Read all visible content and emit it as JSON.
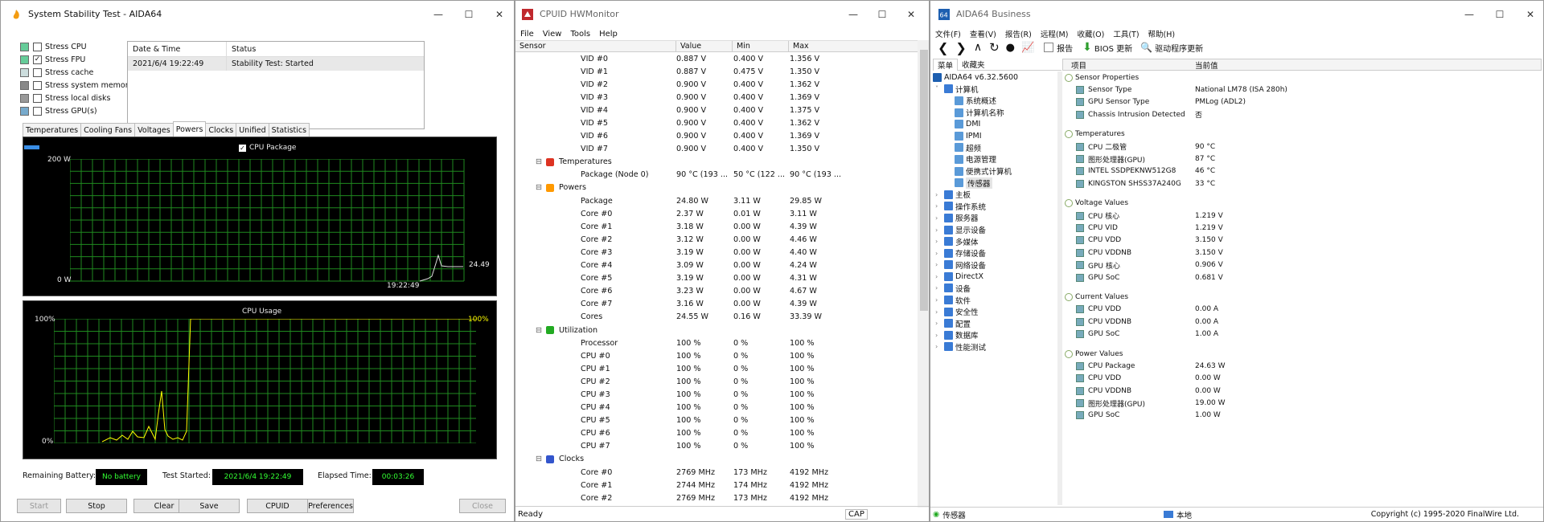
{
  "stability": {
    "title": "System Stability Test - AIDA64",
    "checks": [
      {
        "label": "Stress CPU",
        "checked": false
      },
      {
        "label": "Stress FPU",
        "checked": true
      },
      {
        "label": "Stress cache",
        "checked": false
      },
      {
        "label": "Stress system memory",
        "checked": false
      },
      {
        "label": "Stress local disks",
        "checked": false
      },
      {
        "label": "Stress GPU(s)",
        "checked": false
      }
    ],
    "log": {
      "col_date": "Date & Time",
      "col_status": "Status",
      "date": "2021/6/4 19:22:49",
      "status": "Stability Test: Started"
    },
    "tabs": [
      "Temperatures",
      "Cooling Fans",
      "Voltages",
      "Powers",
      "Clocks",
      "Unified",
      "Statistics"
    ],
    "active_tab": "Powers",
    "power_graph": {
      "legend": "CPU Package",
      "ymax": "200 W",
      "ymin": "0 W",
      "time": "19:22:49",
      "current": "24.49"
    },
    "usage_graph": {
      "title": "CPU Usage",
      "ymax": "100%",
      "ymin": "0%",
      "current": "100%"
    },
    "status": {
      "battery_label": "Remaining Battery:",
      "battery": "No battery",
      "started_label": "Test Started:",
      "started": "2021/6/4 19:22:49",
      "elapsed_label": "Elapsed Time:",
      "elapsed": "00:03:26"
    },
    "buttons": {
      "start": "Start",
      "stop": "Stop",
      "clear": "Clear",
      "save": "Save",
      "cpuid": "CPUID",
      "prefs": "Preferences",
      "close": "Close"
    }
  },
  "hwmonitor": {
    "title": "CPUID HWMonitor",
    "menu": [
      "File",
      "View",
      "Tools",
      "Help"
    ],
    "columns": [
      "Sensor",
      "Value",
      "Min",
      "Max"
    ],
    "rows": [
      {
        "t": "item",
        "name": "VID #0",
        "value": "0.887 V",
        "min": "0.400 V",
        "max": "1.356 V"
      },
      {
        "t": "item",
        "name": "VID #1",
        "value": "0.887 V",
        "min": "0.475 V",
        "max": "1.350 V"
      },
      {
        "t": "item",
        "name": "VID #2",
        "value": "0.900 V",
        "min": "0.400 V",
        "max": "1.362 V"
      },
      {
        "t": "item",
        "name": "VID #3",
        "value": "0.900 V",
        "min": "0.400 V",
        "max": "1.369 V"
      },
      {
        "t": "item",
        "name": "VID #4",
        "value": "0.900 V",
        "min": "0.400 V",
        "max": "1.375 V"
      },
      {
        "t": "item",
        "name": "VID #5",
        "value": "0.900 V",
        "min": "0.400 V",
        "max": "1.362 V"
      },
      {
        "t": "item",
        "name": "VID #6",
        "value": "0.900 V",
        "min": "0.400 V",
        "max": "1.369 V"
      },
      {
        "t": "item",
        "name": "VID #7",
        "value": "0.900 V",
        "min": "0.400 V",
        "max": "1.350 V"
      },
      {
        "t": "group",
        "name": "Temperatures",
        "icon": "thermometer-icon",
        "color": "#d32"
      },
      {
        "t": "item",
        "name": "Package (Node 0)",
        "value": "90 °C  (193 ...",
        "min": "50 °C  (122 ...",
        "max": "90 °C  (193 ..."
      },
      {
        "t": "group",
        "name": "Powers",
        "icon": "flame-icon",
        "color": "#f90"
      },
      {
        "t": "item",
        "name": "Package",
        "value": "24.80 W",
        "min": "3.11 W",
        "max": "29.85 W"
      },
      {
        "t": "item",
        "name": "Core #0",
        "value": "2.37 W",
        "min": "0.01 W",
        "max": "3.11 W"
      },
      {
        "t": "item",
        "name": "Core #1",
        "value": "3.18 W",
        "min": "0.00 W",
        "max": "4.39 W"
      },
      {
        "t": "item",
        "name": "Core #2",
        "value": "3.12 W",
        "min": "0.00 W",
        "max": "4.46 W"
      },
      {
        "t": "item",
        "name": "Core #3",
        "value": "3.19 W",
        "min": "0.00 W",
        "max": "4.40 W"
      },
      {
        "t": "item",
        "name": "Core #4",
        "value": "3.09 W",
        "min": "0.00 W",
        "max": "4.24 W"
      },
      {
        "t": "item",
        "name": "Core #5",
        "value": "3.19 W",
        "min": "0.00 W",
        "max": "4.31 W"
      },
      {
        "t": "item",
        "name": "Core #6",
        "value": "3.23 W",
        "min": "0.00 W",
        "max": "4.67 W"
      },
      {
        "t": "item",
        "name": "Core #7",
        "value": "3.16 W",
        "min": "0.00 W",
        "max": "4.39 W"
      },
      {
        "t": "item",
        "name": "Cores",
        "value": "24.55 W",
        "min": "0.16 W",
        "max": "33.39 W"
      },
      {
        "t": "group",
        "name": "Utilization",
        "icon": "utilization-icon",
        "color": "#2a2"
      },
      {
        "t": "item",
        "name": "Processor",
        "value": "100 %",
        "min": "0 %",
        "max": "100 %"
      },
      {
        "t": "item",
        "name": "CPU #0",
        "value": "100 %",
        "min": "0 %",
        "max": "100 %"
      },
      {
        "t": "item",
        "name": "CPU #1",
        "value": "100 %",
        "min": "0 %",
        "max": "100 %"
      },
      {
        "t": "item",
        "name": "CPU #2",
        "value": "100 %",
        "min": "0 %",
        "max": "100 %"
      },
      {
        "t": "item",
        "name": "CPU #3",
        "value": "100 %",
        "min": "0 %",
        "max": "100 %"
      },
      {
        "t": "item",
        "name": "CPU #4",
        "value": "100 %",
        "min": "0 %",
        "max": "100 %"
      },
      {
        "t": "item",
        "name": "CPU #5",
        "value": "100 %",
        "min": "0 %",
        "max": "100 %"
      },
      {
        "t": "item",
        "name": "CPU #6",
        "value": "100 %",
        "min": "0 %",
        "max": "100 %"
      },
      {
        "t": "item",
        "name": "CPU #7",
        "value": "100 %",
        "min": "0 %",
        "max": "100 %"
      },
      {
        "t": "group",
        "name": "Clocks",
        "icon": "clocks-icon",
        "color": "#35c"
      },
      {
        "t": "item",
        "name": "Core #0",
        "value": "2769 MHz",
        "min": "173 MHz",
        "max": "4192 MHz"
      },
      {
        "t": "item",
        "name": "Core #1",
        "value": "2744 MHz",
        "min": "174 MHz",
        "max": "4192 MHz"
      },
      {
        "t": "item",
        "name": "Core #2",
        "value": "2769 MHz",
        "min": "173 MHz",
        "max": "4192 MHz"
      }
    ],
    "status": "Ready",
    "cap": "CAP"
  },
  "business": {
    "title": "AIDA64 Business",
    "menu": [
      "文件(F)",
      "查看(V)",
      "报告(R)",
      "远程(M)",
      "收藏(O)",
      "工具(T)",
      "帮助(H)"
    ],
    "toolbar": {
      "report": "报告",
      "bios": "BIOS 更新",
      "driver": "驱动程序更新"
    },
    "tree_tabs": [
      "菜单",
      "收藏夹"
    ],
    "tree": [
      {
        "label": "AIDA64 v6.32.5600",
        "level": 0,
        "icon": "aida-icon"
      },
      {
        "label": "计算机",
        "level": 1,
        "icon": "computer-icon",
        "exp": "v"
      },
      {
        "label": "系统概述",
        "level": 2,
        "icon": "summary-icon"
      },
      {
        "label": "计算机名称",
        "level": 2,
        "icon": "computer-name-icon"
      },
      {
        "label": "DMI",
        "level": 2,
        "icon": "dmi-icon"
      },
      {
        "label": "IPMI",
        "level": 2,
        "icon": "ipmi-icon"
      },
      {
        "label": "超频",
        "level": 2,
        "icon": "overclock-icon"
      },
      {
        "label": "电源管理",
        "level": 2,
        "icon": "power-mgmt-icon"
      },
      {
        "label": "便携式计算机",
        "level": 2,
        "icon": "portable-icon"
      },
      {
        "label": "传感器",
        "level": 2,
        "icon": "sensor-icon",
        "selected": true
      },
      {
        "label": "主板",
        "level": 1,
        "icon": "motherboard-icon",
        "exp": ">"
      },
      {
        "label": "操作系统",
        "level": 1,
        "icon": "os-icon",
        "exp": ">"
      },
      {
        "label": "服务器",
        "level": 1,
        "icon": "server-icon",
        "exp": ">"
      },
      {
        "label": "显示设备",
        "level": 1,
        "icon": "display-icon",
        "exp": ">"
      },
      {
        "label": "多媒体",
        "level": 1,
        "icon": "multimedia-icon",
        "exp": ">"
      },
      {
        "label": "存储设备",
        "level": 1,
        "icon": "storage-icon",
        "exp": ">"
      },
      {
        "label": "网络设备",
        "level": 1,
        "icon": "network-icon",
        "exp": ">"
      },
      {
        "label": "DirectX",
        "level": 1,
        "icon": "directx-icon",
        "exp": ">"
      },
      {
        "label": "设备",
        "level": 1,
        "icon": "devices-icon",
        "exp": ">"
      },
      {
        "label": "软件",
        "level": 1,
        "icon": "software-icon",
        "exp": ">"
      },
      {
        "label": "安全性",
        "level": 1,
        "icon": "security-icon",
        "exp": ">"
      },
      {
        "label": "配置",
        "level": 1,
        "icon": "config-icon",
        "exp": ">"
      },
      {
        "label": "数据库",
        "level": 1,
        "icon": "database-icon",
        "exp": ">"
      },
      {
        "label": "性能测试",
        "level": 1,
        "icon": "benchmark-icon",
        "exp": ">"
      }
    ],
    "columns": [
      "项目",
      "当前值"
    ],
    "props": [
      {
        "t": "group",
        "k": "Sensor Properties"
      },
      {
        "t": "item",
        "k": "Sensor Type",
        "v": "National LM78  (ISA 280h)"
      },
      {
        "t": "item",
        "k": "GPU Sensor Type",
        "v": "PMLog  (ADL2)"
      },
      {
        "t": "item",
        "k": "Chassis Intrusion Detected",
        "v": "否"
      },
      {
        "t": "gap"
      },
      {
        "t": "group",
        "k": "Temperatures"
      },
      {
        "t": "item",
        "k": "CPU 二极管",
        "v": "90 °C"
      },
      {
        "t": "item",
        "k": "图形处理器(GPU)",
        "v": "87 °C"
      },
      {
        "t": "item",
        "k": "INTEL SSDPEKNW512G8",
        "v": "46 °C"
      },
      {
        "t": "item",
        "k": "KINGSTON SHSS37A240G",
        "v": "33 °C"
      },
      {
        "t": "gap"
      },
      {
        "t": "group",
        "k": "Voltage Values"
      },
      {
        "t": "item",
        "k": "CPU 核心",
        "v": "1.219 V"
      },
      {
        "t": "item",
        "k": "CPU VID",
        "v": "1.219 V"
      },
      {
        "t": "item",
        "k": "CPU VDD",
        "v": "3.150 V"
      },
      {
        "t": "item",
        "k": "CPU VDDNB",
        "v": "3.150 V"
      },
      {
        "t": "item",
        "k": "GPU 核心",
        "v": "0.906 V"
      },
      {
        "t": "item",
        "k": "GPU SoC",
        "v": "0.681 V"
      },
      {
        "t": "gap"
      },
      {
        "t": "group",
        "k": "Current Values"
      },
      {
        "t": "item",
        "k": "CPU VDD",
        "v": "0.00 A"
      },
      {
        "t": "item",
        "k": "CPU VDDNB",
        "v": "0.00 A"
      },
      {
        "t": "item",
        "k": "GPU SoC",
        "v": "1.00 A"
      },
      {
        "t": "gap"
      },
      {
        "t": "group",
        "k": "Power Values"
      },
      {
        "t": "item",
        "k": "CPU Package",
        "v": "24.63 W"
      },
      {
        "t": "item",
        "k": "CPU VDD",
        "v": "0.00 W"
      },
      {
        "t": "item",
        "k": "CPU VDDNB",
        "v": "0.00 W"
      },
      {
        "t": "item",
        "k": "图形处理器(GPU)",
        "v": "19.00 W"
      },
      {
        "t": "item",
        "k": "GPU SoC",
        "v": "1.00 W"
      }
    ],
    "status": {
      "left": "传感器",
      "mid": "本地",
      "right": "Copyright (c) 1995-2020 FinalWire Ltd."
    }
  }
}
